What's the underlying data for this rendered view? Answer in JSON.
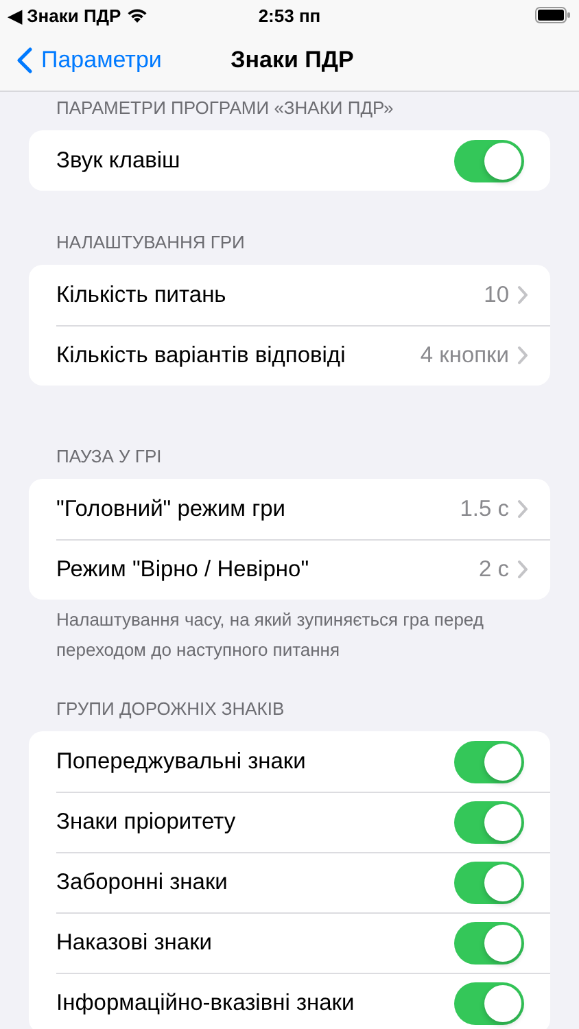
{
  "status_bar": {
    "back_app": "◀ Знаки ПДР",
    "time": "2:53 пп"
  },
  "nav": {
    "back": "Параметри",
    "title": "Знаки ПДР"
  },
  "sections": [
    {
      "header": "ПАРАМЕТРИ ПРОГРАМИ «ЗНАКИ ПДР»",
      "rows": [
        {
          "kind": "toggle",
          "label": "Звук клавіш",
          "on": true
        }
      ]
    },
    {
      "header": "НАЛАШТУВАННЯ ГРИ",
      "rows": [
        {
          "kind": "link",
          "label": "Кількість питань",
          "value": "10"
        },
        {
          "kind": "link",
          "label": "Кількість варіантів відповіді",
          "value": "4 кнопки"
        }
      ]
    },
    {
      "header": "ПАУЗА У ГРІ",
      "rows": [
        {
          "kind": "link",
          "label": "\"Головний\" режим гри",
          "value": "1.5 с"
        },
        {
          "kind": "link",
          "label": "Режим \"Вірно / Невірно\"",
          "value": "2 с"
        }
      ],
      "footer": "Налаштування часу, на який зупиняється гра перед переходом до наступного питання"
    },
    {
      "header": "ГРУПИ ДОРОЖНІХ ЗНАКІВ",
      "rows": [
        {
          "kind": "toggle",
          "label": "Попереджувальні знаки",
          "on": true
        },
        {
          "kind": "toggle",
          "label": "Знаки пріоритету",
          "on": true
        },
        {
          "kind": "toggle",
          "label": "Заборонні знаки",
          "on": true
        },
        {
          "kind": "toggle",
          "label": "Наказові знаки",
          "on": true
        },
        {
          "kind": "toggle",
          "label": "Інформаційно-вказівні знаки",
          "on": true
        }
      ]
    }
  ]
}
